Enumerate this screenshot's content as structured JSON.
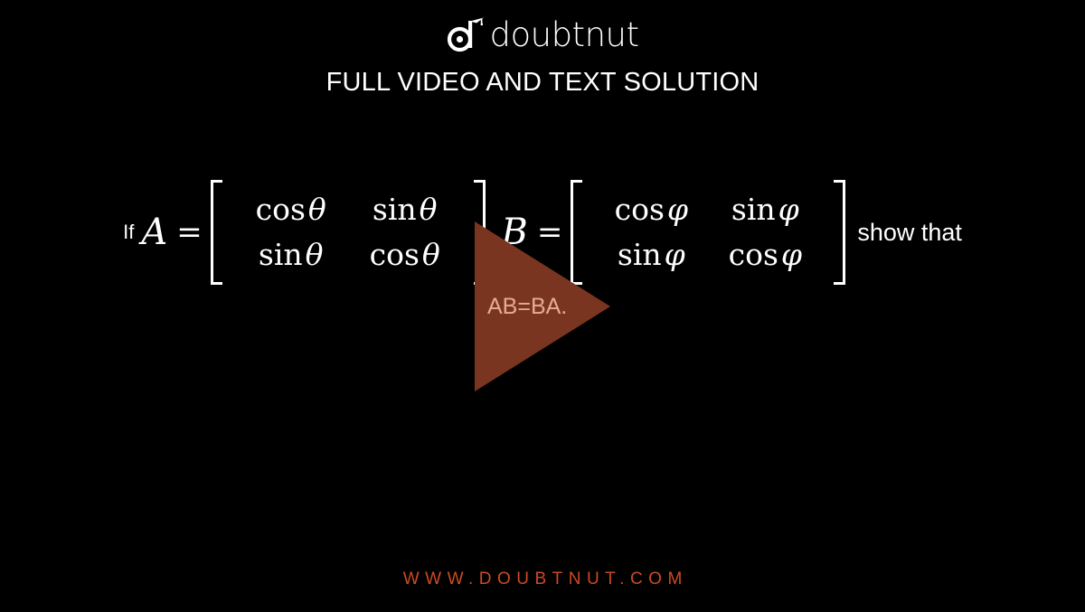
{
  "background_color": "#000000",
  "brand": {
    "wordmark": "doubtnut",
    "logo_icon": "doubtnut-d-graduation-cap-icon",
    "color": "#ffffff"
  },
  "header": {
    "title": "FULL VIDEO AND TEXT SOLUTION"
  },
  "problem": {
    "lead_text": "If",
    "trailing_text": "show that",
    "equals_sign": "=",
    "comma": ",",
    "matrices": [
      {
        "name": "A",
        "rows": [
          [
            {
              "fn": "cos",
              "arg": "θ"
            },
            {
              "fn": "sin",
              "arg": "θ"
            }
          ],
          [
            {
              "fn": "sin",
              "arg": "θ"
            },
            {
              "fn": "cos",
              "arg": "θ"
            }
          ]
        ]
      },
      {
        "name": "B",
        "rows": [
          [
            {
              "fn": "cos",
              "arg": "φ"
            },
            {
              "fn": "sin",
              "arg": "φ"
            }
          ],
          [
            {
              "fn": "sin",
              "arg": "φ"
            },
            {
              "fn": "cos",
              "arg": "φ"
            }
          ]
        ]
      }
    ],
    "conclusion": "AB=BA."
  },
  "player": {
    "play_icon": "play-triangle-icon",
    "triangle_color": "#7a3520",
    "caption": "AB=BA.",
    "caption_color": "#e3ab96"
  },
  "footer": {
    "url": "WWW.DOUBTNUT.COM",
    "color": "#cd4a23"
  }
}
